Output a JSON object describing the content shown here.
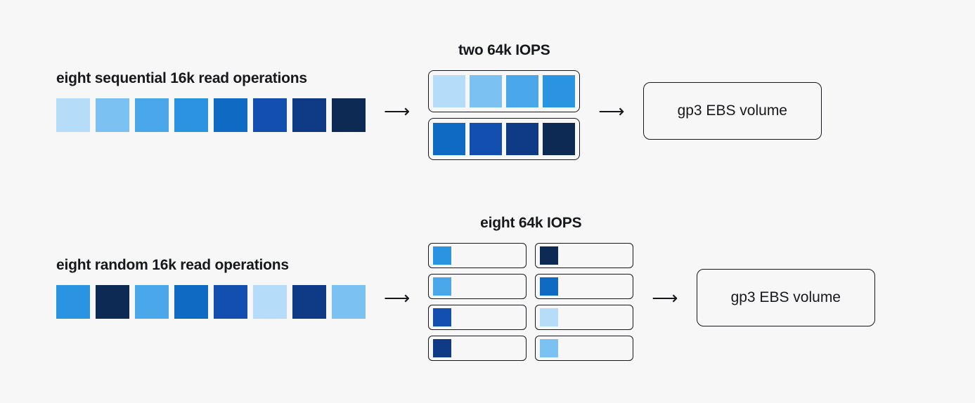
{
  "colors": {
    "c1": "#b5dcf9",
    "c2": "#7bc2f3",
    "c3": "#4aa8ea",
    "c4": "#2a93e2",
    "c5": "#0f6ac4",
    "c6": "#124fae",
    "c7": "#0f3a86",
    "c8": "#0d2a54"
  },
  "sequential": {
    "left_label": "eight sequential 16k read operations",
    "mid_label": "two 64k IOPS",
    "left_blocks": [
      "c1",
      "c2",
      "c3",
      "c4",
      "c5",
      "c6",
      "c7",
      "c8"
    ],
    "groups": [
      [
        "c1",
        "c2",
        "c3",
        "c4"
      ],
      [
        "c5",
        "c6",
        "c7",
        "c8"
      ]
    ],
    "volume_label": "gp3 EBS volume"
  },
  "random": {
    "left_label": "eight random 16k read operations",
    "mid_label": "eight 64k IOPS",
    "left_blocks": [
      "c4",
      "c8",
      "c3",
      "c5",
      "c6",
      "c1",
      "c7",
      "c2"
    ],
    "groups": [
      [
        "c4"
      ],
      [
        "c8"
      ],
      [
        "c3"
      ],
      [
        "c5"
      ],
      [
        "c6"
      ],
      [
        "c1"
      ],
      [
        "c7"
      ],
      [
        "c2"
      ]
    ],
    "volume_label": "gp3 EBS volume"
  }
}
